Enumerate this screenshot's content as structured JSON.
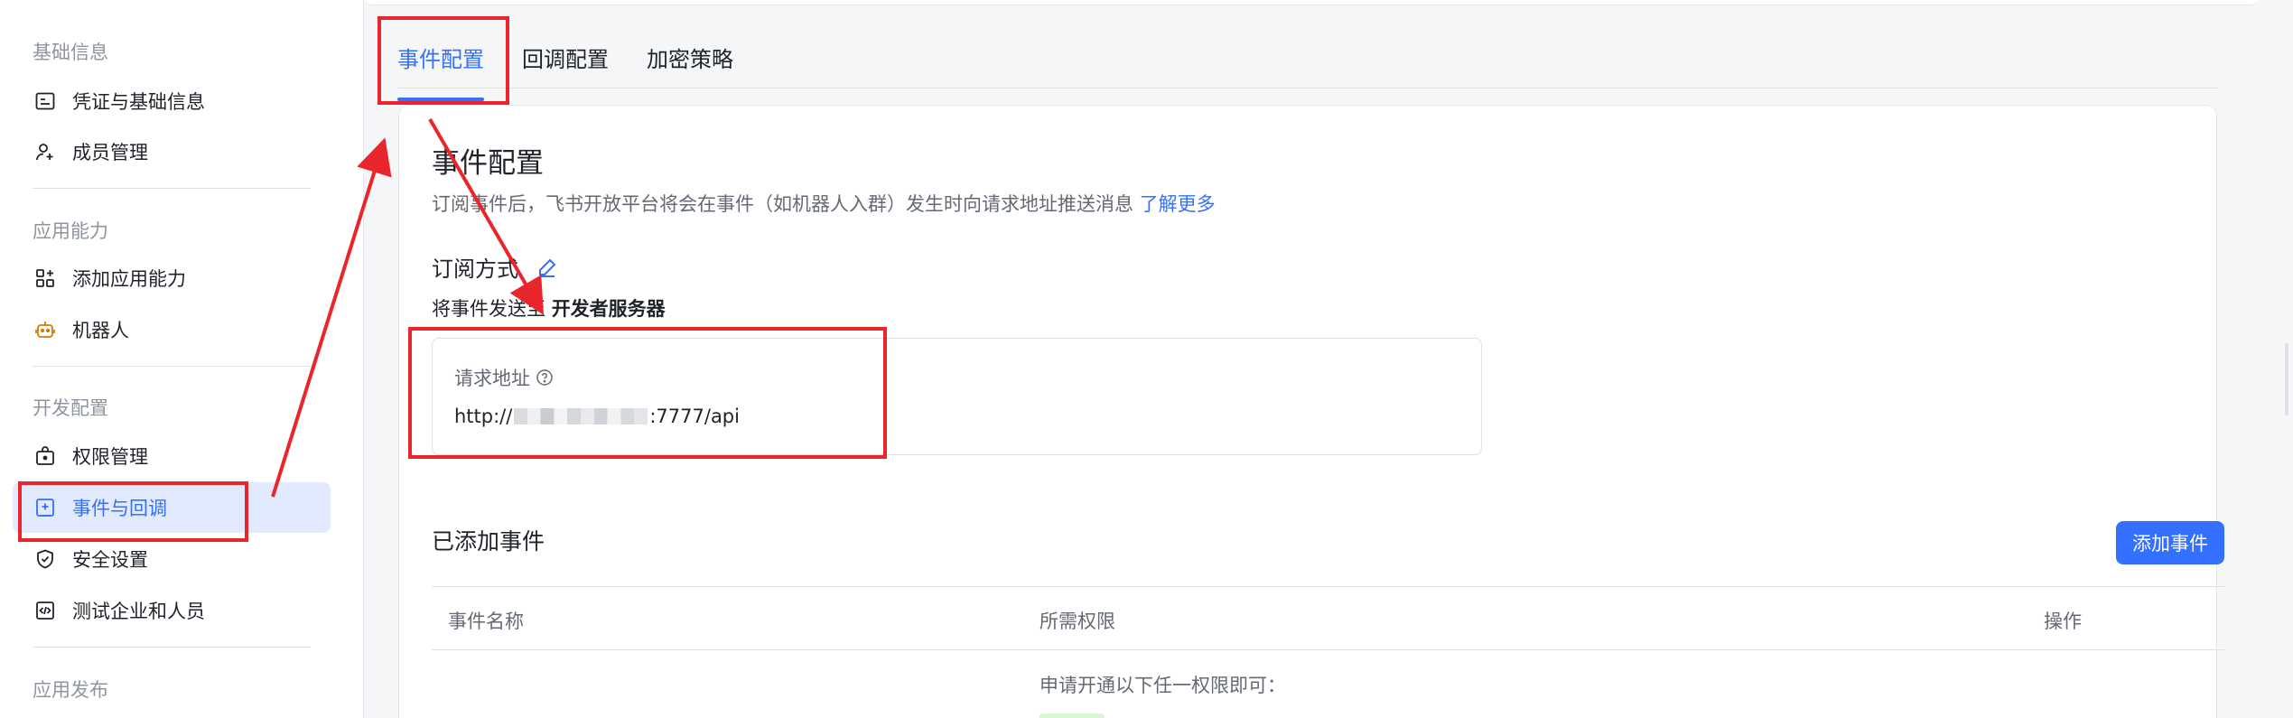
{
  "sidebar": {
    "sections": [
      {
        "title": "基础信息",
        "items": [
          {
            "label": "凭证与基础信息",
            "icon": "credentials-icon"
          },
          {
            "label": "成员管理",
            "icon": "add-member-icon"
          }
        ]
      },
      {
        "title": "应用能力",
        "items": [
          {
            "label": "添加应用能力",
            "icon": "app-grid-icon"
          },
          {
            "label": "机器人",
            "icon": "robot-icon"
          }
        ]
      },
      {
        "title": "开发配置",
        "items": [
          {
            "label": "权限管理",
            "icon": "permission-lock-icon"
          },
          {
            "label": "事件与回调",
            "icon": "event-callback-icon",
            "active": true
          },
          {
            "label": "安全设置",
            "icon": "shield-check-icon"
          },
          {
            "label": "测试企业和人员",
            "icon": "code-box-icon"
          }
        ]
      },
      {
        "title": "应用发布",
        "items": []
      }
    ]
  },
  "tabs": [
    {
      "label": "事件配置",
      "active": true
    },
    {
      "label": "回调配置",
      "active": false
    },
    {
      "label": "加密策略",
      "active": false
    }
  ],
  "event_config": {
    "title": "事件配置",
    "description": "订阅事件后，飞书开放平台将会在事件（如机器人入群）发生时向请求地址推送消息",
    "learn_more": "了解更多",
    "subscribe_method_label": "订阅方式",
    "send_to_prefix": "将事件发送至",
    "send_to_target": "开发者服务器",
    "request_url_label": "请求地址",
    "request_url_prefix": "http://",
    "request_url_suffix": ":7777/api"
  },
  "added_events": {
    "title": "已添加事件",
    "add_button": "添加事件",
    "columns": [
      "事件名称",
      "所需权限",
      "操作"
    ],
    "permission_hint": "申请开通以下任一权限即可："
  },
  "colors": {
    "accent": "#3370ff",
    "annotation": "#e8262b",
    "active_bg": "#e1eaff"
  }
}
